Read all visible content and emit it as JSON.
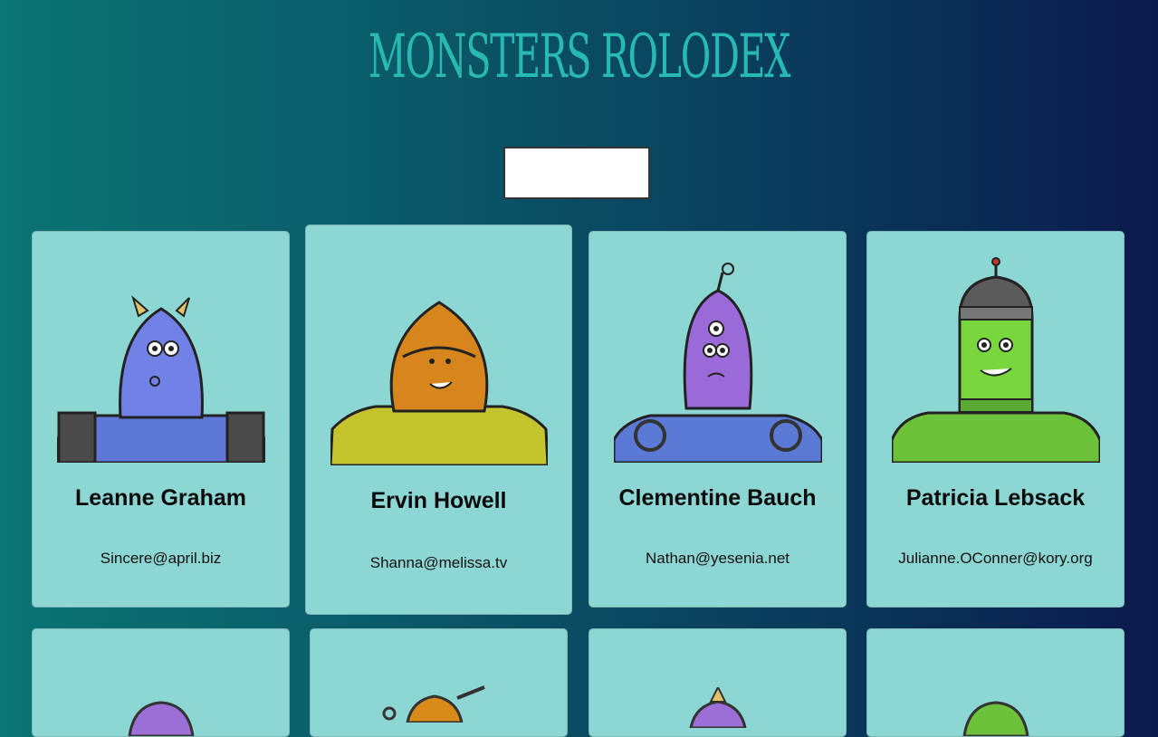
{
  "header": {
    "title": "MONSTERS ROLODEX"
  },
  "search": {
    "value": "",
    "placeholder": ""
  },
  "cards": [
    {
      "name": "Leanne Graham",
      "email": "Sincere@april.biz",
      "monster_color": "#6b7fe0"
    },
    {
      "name": "Ervin Howell",
      "email": "Shanna@melissa.tv",
      "monster_color": "#d98b1a"
    },
    {
      "name": "Clementine Bauch",
      "email": "Nathan@yesenia.net",
      "monster_color": "#9b6fd6"
    },
    {
      "name": "Patricia Lebsack",
      "email": "Julianne.OConner@kory.org",
      "monster_color": "#6cc23a"
    }
  ]
}
